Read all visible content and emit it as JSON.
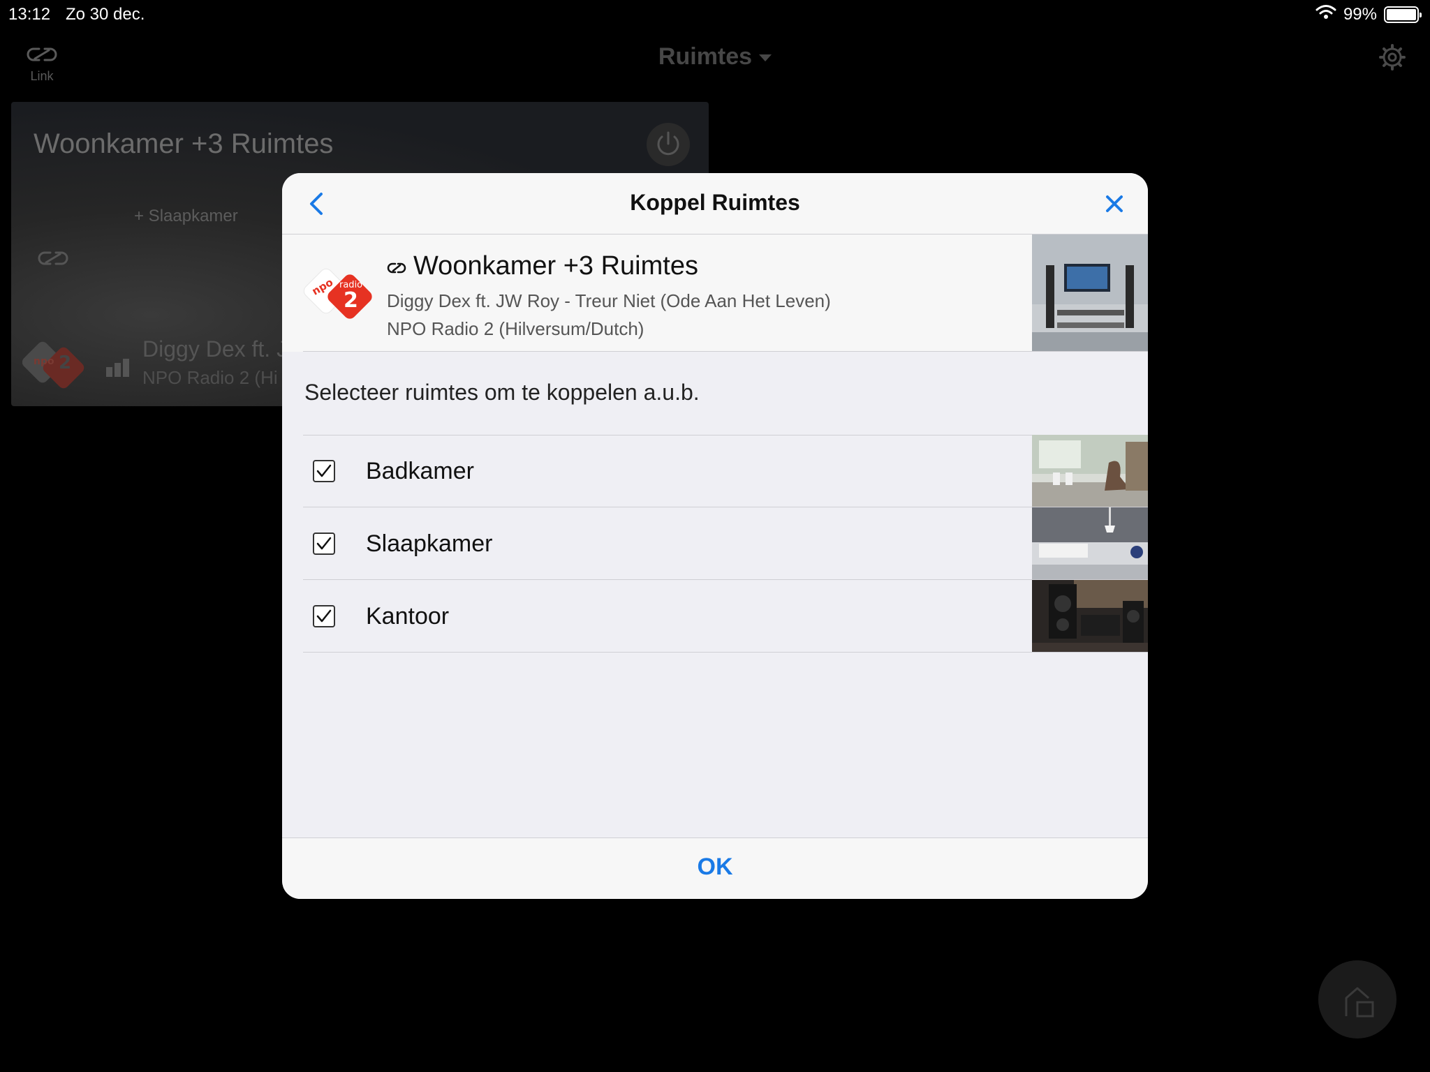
{
  "status_bar": {
    "time": "13:12",
    "date": "Zo 30 dec.",
    "battery": "99%",
    "battery_level": 0.99
  },
  "topbar": {
    "link_label": "Link",
    "title": "Ruimtes"
  },
  "background_card": {
    "title": "Woonkamer +3 Ruimtes",
    "subtitle": "+ Slaapkamer",
    "track": "Diggy Dex ft. J",
    "station": "NPO Radio 2 (Hi"
  },
  "modal": {
    "title": "Koppel Ruimtes",
    "group": {
      "name": "Woonkamer +3 Ruimtes",
      "track": "Diggy Dex ft. JW Roy - Treur Niet (Ode Aan Het Leven)",
      "station": "NPO Radio 2 (Hilversum/Dutch)"
    },
    "instruction": "Selecteer ruimtes om te koppelen a.u.b.",
    "rooms": [
      {
        "name": "Badkamer",
        "checked": true
      },
      {
        "name": "Slaapkamer",
        "checked": true
      },
      {
        "name": "Kantoor",
        "checked": true
      }
    ],
    "ok_label": "OK"
  },
  "logo_text": {
    "npo": "npo",
    "radio": "radio",
    "number": "2"
  },
  "icons": {
    "link": "link-icon",
    "caret": "chevron-down-icon",
    "gear": "gear-icon",
    "back": "chevron-left-icon",
    "close": "close-icon",
    "check": "checkmark-icon",
    "home": "home-icon",
    "wifi": "wifi-icon",
    "power": "power-icon"
  },
  "colors": {
    "accent": "#1a7ae6",
    "modal_background": "#efeff4",
    "npo_red": "#e63222"
  }
}
